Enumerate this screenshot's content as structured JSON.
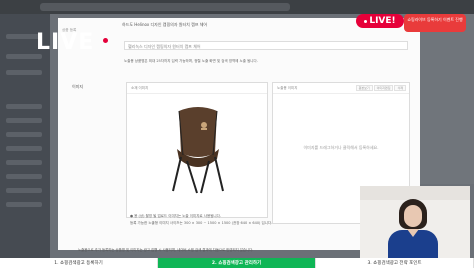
{
  "overlay": {
    "logo_text": "LIVE",
    "live_badge": "LIVE!",
    "corner_badge": "쇼핑라이브 등록하기 이벤트 진행"
  },
  "modal": {
    "title": "하드도 Helinox 디자인 캠핑의자 원터치 캠프 체어",
    "subtitle": "상품 등록",
    "close_label": "×",
    "product_input": "헬리녹스 디자인 캠핑의자 원터치 캠프 체어",
    "notice": "노출용 상품명은 최대 25자까지 입력 가능하며, 정렬 노출 화면 및 검색 영역에 노출 됩니다.",
    "image_field_label": "이미지",
    "box1_label": "소재 이미지",
    "box2_label": "노출용 이미지",
    "box2_buttons": [
      "원본보기",
      "이미지편집",
      "삭제"
    ],
    "box2_placeholder": "이미지를 드래그하거나 클릭해서 등록하세요.",
    "info_line1": "● 용 (상) 촬영 될 업로드 이미지는 노출 이미지로 사용됩니다.",
    "info_line2": "등록 가능한 노출형 이미지 사이즈는 300 × 300 ~ 1500 × 1500 (권장 640 × 640) 입니다.",
    "footer_note": "노출용으로 추가 등록하는 상품명 및 이미지는 광고 집행 시 사용되며, 네이버 쇼핑 검색 결과에 자동으로 반영되지 않습니다."
  },
  "steps": [
    {
      "label": "1. 쇼핑검색광고 등록하기",
      "active": false
    },
    {
      "label": "2. 쇼핑검색광고 관리하기",
      "active": true
    },
    {
      "label": "3. 쇼핑검색광고 전략 포인트",
      "active": false
    }
  ],
  "colors": {
    "accent_green": "#0fb656",
    "live_red": "#e60039"
  }
}
